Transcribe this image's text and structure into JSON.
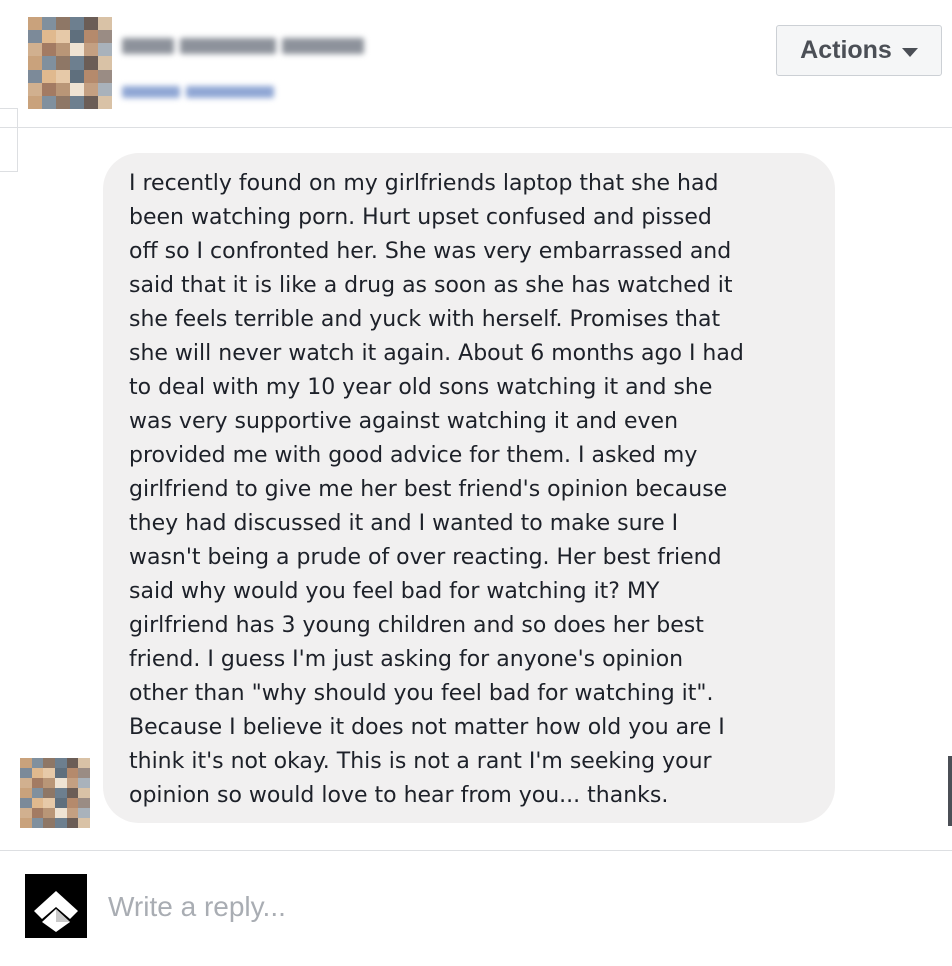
{
  "header": {
    "actions_label": "Actions"
  },
  "message": {
    "text": "I recently found on my girlfriends laptop that she had\nbeen watching porn. Hurt upset confused and pissed\noff so I confronted her. She was very embarrassed and\nsaid that it is like a drug as soon as she has watched it\nshe feels terrible and yuck with herself. Promises that\nshe will never watch it again. About 6 months ago I had\nto deal with my 10 year old sons watching it and she\nwas very supportive against watching it and even\nprovided me with good advice for them. I asked my\ngirlfriend to give me her best friend's opinion because\nthey had discussed it and I wanted to make sure I\nwasn't being a prude of over reacting. Her best friend\nsaid why would you feel bad for watching it? MY\ngirlfriend has 3 young children and so does her best\nfriend. I guess I'm just asking for anyone's opinion\nother than \"why should you feel bad for watching it\".\nBecause I believe it does not matter how old you are I\nthink it's not okay. This is not a rant I'm seeking your\nopinion so would love to hear from you... thanks."
  },
  "reply": {
    "placeholder": "Write a reply..."
  },
  "colors": {
    "bubble_background": "#f1f0f0",
    "text": "#1d2129",
    "divider": "#dddfe2",
    "button_background": "#f5f6f7",
    "placeholder": "#a9adb3"
  },
  "icons": {
    "actions_caret": "caret-down-icon",
    "reply_logo": "chevron-up-logo-icon"
  }
}
